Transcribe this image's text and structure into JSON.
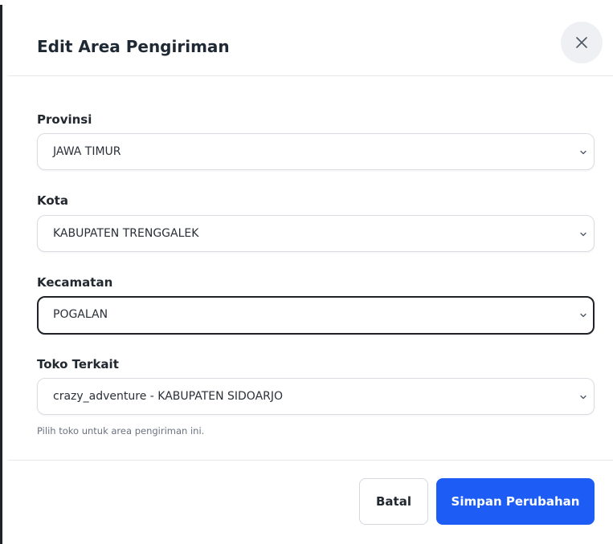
{
  "modal": {
    "title": "Edit Area Pengiriman",
    "close_icon": "close-icon"
  },
  "form": {
    "province": {
      "label": "Provinsi",
      "value": "JAWA TIMUR"
    },
    "city": {
      "label": "Kota",
      "value": "KABUPATEN TRENGGALEK"
    },
    "district": {
      "label": "Kecamatan",
      "value": "POGALAN"
    },
    "store": {
      "label": "Toko Terkait",
      "value": "crazy_adventure - KABUPATEN SIDOARJO",
      "help": "Pilih toko untuk area pengiriman ini."
    }
  },
  "footer": {
    "cancel_label": "Batal",
    "save_label": "Simpan Perubahan"
  },
  "colors": {
    "primary": "#1d5cf5",
    "focus_border": "#1f2328",
    "border": "#d9dde2"
  }
}
